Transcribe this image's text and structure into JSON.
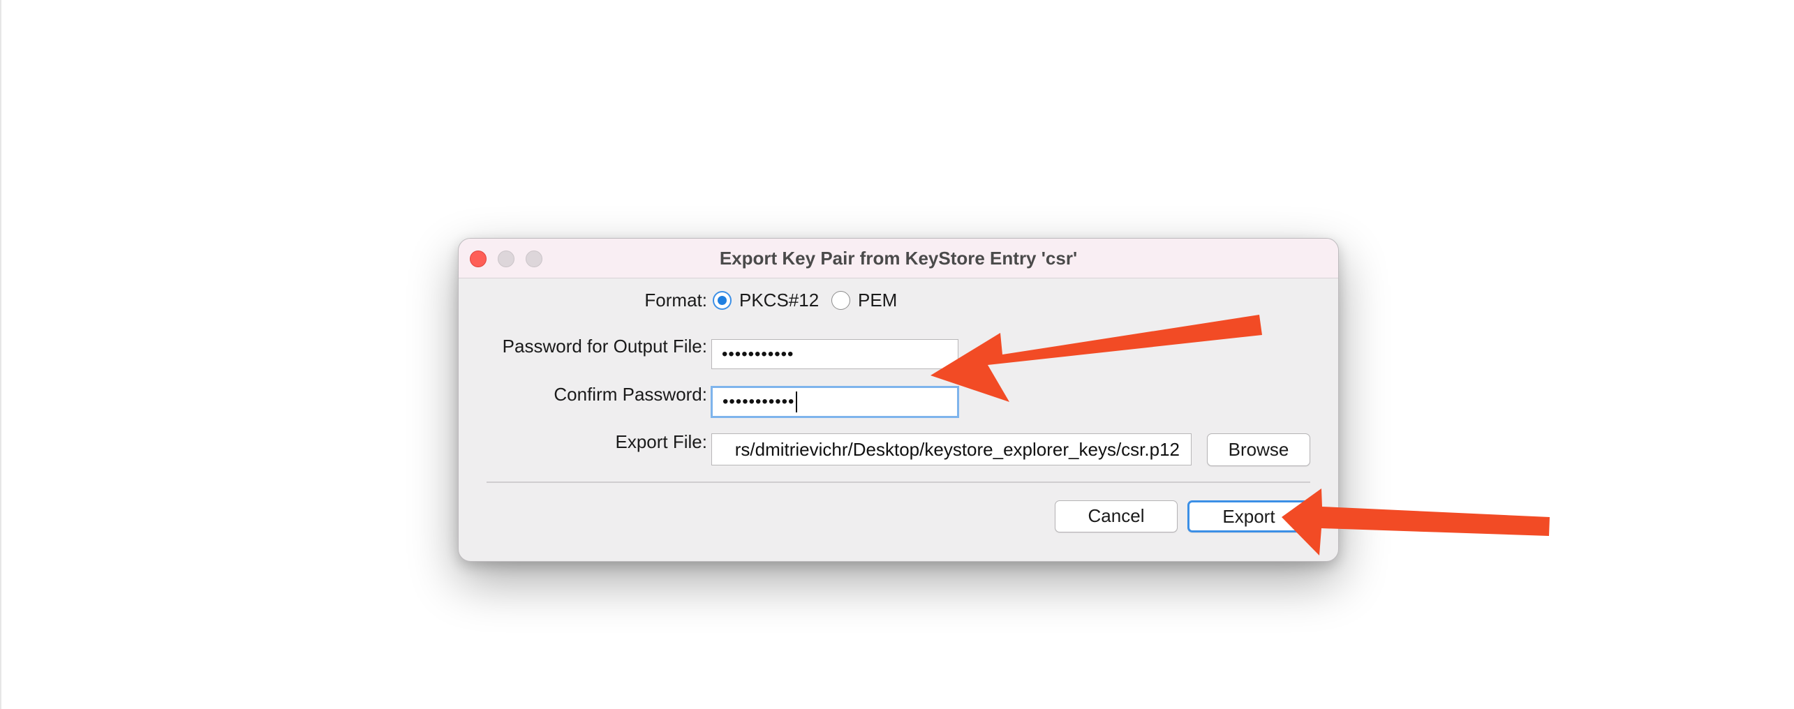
{
  "dialog": {
    "title": "Export Key Pair from KeyStore Entry 'csr'",
    "format_label": "Format:",
    "format_options": [
      {
        "label": "PKCS#12",
        "selected": true
      },
      {
        "label": "PEM",
        "selected": false
      }
    ],
    "password_label": "Password for Output File:",
    "password_value": "•••••••••••",
    "confirm_label": "Confirm Password:",
    "confirm_value": "•••••••••••",
    "export_file_label": "Export File:",
    "export_file_value": "rs/dmitrievichr/Desktop/keystore_explorer_keys/csr.p12",
    "browse_label": "Browse",
    "cancel_label": "Cancel",
    "export_label": "Export"
  },
  "colors": {
    "annotation_arrow": "#f24b25",
    "accent": "#3b8fe6",
    "close_button": "#fe5f57",
    "titlebar": "#f9eef3",
    "dialog_bg": "#efeeef"
  },
  "icons": {
    "arrow_one": "arrow-pointing-left-icon",
    "arrow_two": "arrow-pointing-left-icon"
  }
}
